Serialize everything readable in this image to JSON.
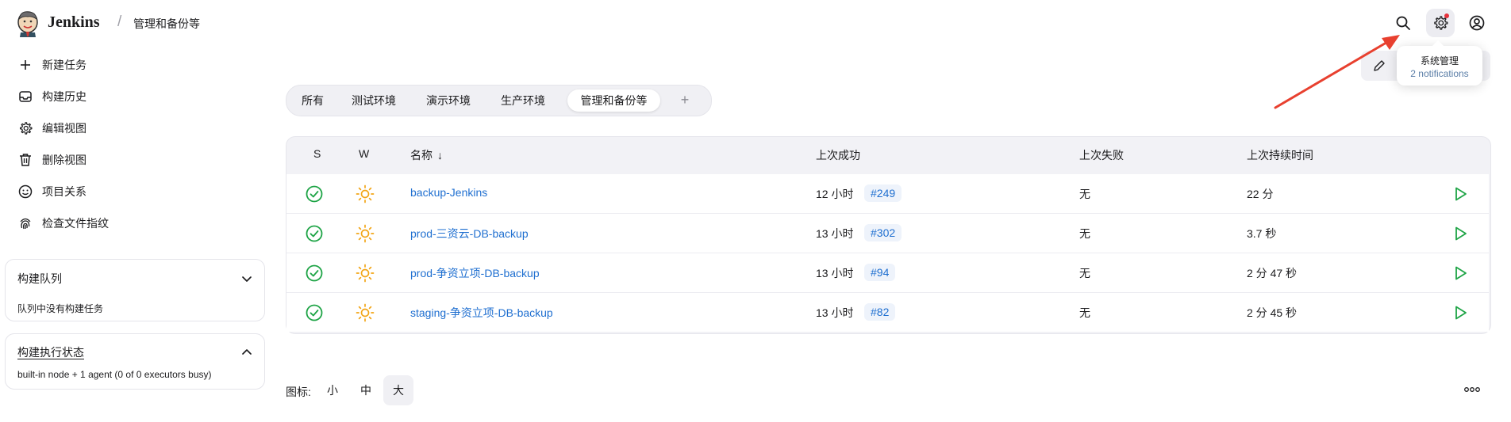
{
  "header": {
    "brand": "Jenkins",
    "separator": "/",
    "breadcrumb": "管理和备份等"
  },
  "tooltip": {
    "title": "系统管理",
    "subtitle": "2 notifications"
  },
  "sidebar": {
    "tasks": [
      {
        "label": "新建任务",
        "icon": "plus-icon"
      },
      {
        "label": "构建历史",
        "icon": "inbox-icon"
      },
      {
        "label": "编辑视图",
        "icon": "gear-icon"
      },
      {
        "label": "删除视图",
        "icon": "trash-icon"
      },
      {
        "label": "项目关系",
        "icon": "smiley-icon"
      },
      {
        "label": "检查文件指纹",
        "icon": "fingerprint-icon"
      }
    ],
    "queue": {
      "title": "构建队列",
      "text": "队列中没有构建任务"
    },
    "executors": {
      "title": "构建执行状态",
      "text": "built-in node + 1 agent (0 of 0 executors busy)"
    }
  },
  "tabs": [
    "所有",
    "测试环境",
    "演示环境",
    "生产环境",
    "管理和备份等"
  ],
  "tab_add": "+",
  "active_tab": "管理和备份等",
  "table": {
    "headers": {
      "s": "S",
      "w": "W",
      "name": "名称",
      "sort_arrow": "↓",
      "last_success": "上次成功",
      "last_failure": "上次失败",
      "last_duration": "上次持续时间"
    },
    "rows": [
      {
        "name": "backup-Jenkins",
        "success_time": "12 小时",
        "build": "#249",
        "failure": "无",
        "duration": "22 分"
      },
      {
        "name": "prod-三资云-DB-backup",
        "success_time": "13 小时",
        "build": "#302",
        "failure": "无",
        "duration": "3.7 秒"
      },
      {
        "name": "prod-争资立项-DB-backup",
        "success_time": "13 小时",
        "build": "#94",
        "failure": "无",
        "duration": "2 分 47 秒"
      },
      {
        "name": "staging-争资立项-DB-backup",
        "success_time": "13 小时",
        "build": "#82",
        "failure": "无",
        "duration": "2 分 45 秒"
      }
    ]
  },
  "footer": {
    "icon_label": "图标:",
    "sizes": [
      "小",
      "中",
      "大"
    ],
    "active_size": "大"
  },
  "colors": {
    "accent": "#1f6fd0",
    "success": "#1ea446",
    "weather": "#f2a516",
    "notification": "#e5323c",
    "annotation_arrow": "#e8402f"
  }
}
